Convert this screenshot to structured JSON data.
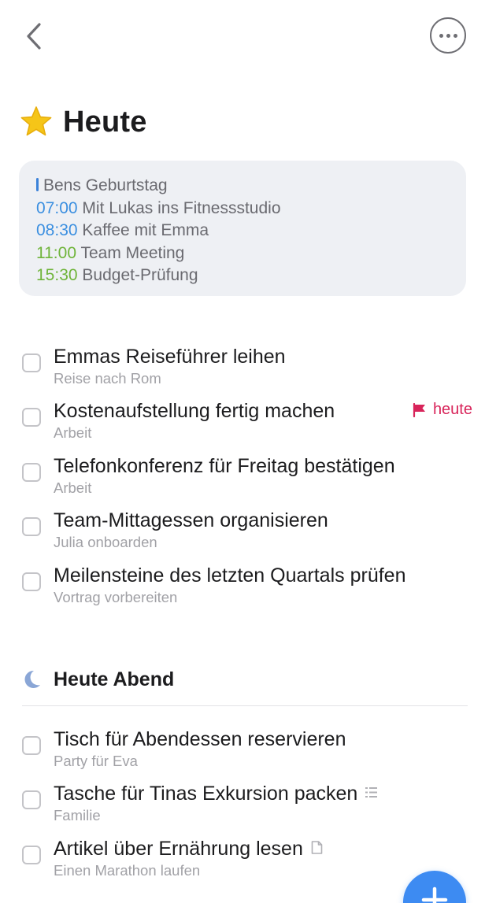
{
  "colors": {
    "accent": "#3d8bf2",
    "calendar_blue": "#3b8fe0",
    "calendar_green": "#6fb43a",
    "deadline_pink": "#d8245a",
    "star_yellow": "#f5c518",
    "moon_blue": "#8aa6d6"
  },
  "header": {
    "back_icon": "chevron-left-icon",
    "more_icon": "ellipsis-circle-icon",
    "title": "Heute",
    "title_icon": "star-icon"
  },
  "calendar": {
    "allday": "Bens Geburtstag",
    "events": [
      {
        "time": "07:00",
        "title": "Mit Lukas ins Fitnessstudio",
        "color": "blue"
      },
      {
        "time": "08:30",
        "title": "Kaffee mit Emma",
        "color": "blue"
      },
      {
        "time": "11:00",
        "title": "Team Meeting",
        "color": "green"
      },
      {
        "time": "15:30",
        "title": "Budget-Prüfung",
        "color": "green"
      }
    ]
  },
  "today_tasks": [
    {
      "title": "Emmas Reiseführer leihen",
      "project": "Reise nach Rom"
    },
    {
      "title": "Kostenaufstellung fertig machen",
      "project": "Arbeit",
      "deadline": "heute"
    },
    {
      "title": "Telefonkonferenz für Freitag bestätigen",
      "project": "Arbeit"
    },
    {
      "title": "Team-Mittagessen organisieren",
      "project": "Julia onboarden"
    },
    {
      "title": "Meilensteine des letzten Quartals prüfen",
      "project": "Vortrag vorbereiten"
    }
  ],
  "evening": {
    "title": "Heute Abend",
    "icon": "moon-icon",
    "tasks": [
      {
        "title": "Tisch für Abendessen reservieren",
        "project": "Party für Eva"
      },
      {
        "title": "Tasche für Tinas Exkursion packen",
        "project": "Familie",
        "icon": "checklist-icon"
      },
      {
        "title": "Artikel über Ernährung lesen",
        "project": "Einen Marathon laufen",
        "icon": "note-icon"
      }
    ]
  },
  "fab": {
    "icon": "plus-icon"
  }
}
